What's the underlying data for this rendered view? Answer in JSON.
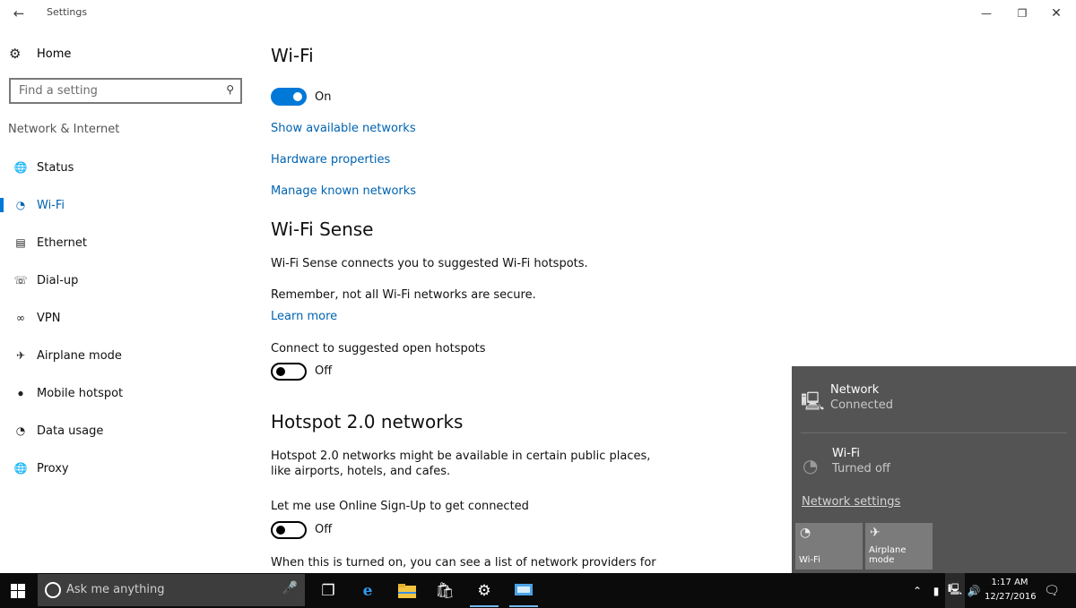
{
  "window": {
    "title": "Settings"
  },
  "sidebar": {
    "home_label": "Home",
    "search_placeholder": "Find a setting",
    "section_label": "Network & Internet",
    "items": [
      {
        "label": "Status",
        "icon": "globe-icon"
      },
      {
        "label": "Wi-Fi",
        "icon": "wifi-icon",
        "active": true
      },
      {
        "label": "Ethernet",
        "icon": "ethernet-icon"
      },
      {
        "label": "Dial-up",
        "icon": "dialup-icon"
      },
      {
        "label": "VPN",
        "icon": "vpn-icon"
      },
      {
        "label": "Airplane mode",
        "icon": "airplane-icon"
      },
      {
        "label": "Mobile hotspot",
        "icon": "hotspot-icon"
      },
      {
        "label": "Data usage",
        "icon": "data-usage-icon"
      },
      {
        "label": "Proxy",
        "icon": "proxy-globe-icon"
      }
    ]
  },
  "main": {
    "wifi_heading": "Wi-Fi",
    "wifi_toggle": {
      "state": "On",
      "on": true
    },
    "links": [
      "Show available networks",
      "Hardware properties",
      "Manage known networks"
    ],
    "sense_heading": "Wi-Fi Sense",
    "sense_text": "Wi-Fi Sense connects you to suggested Wi-Fi hotspots.",
    "sense_warning": "Remember, not all Wi-Fi networks are secure.",
    "learn_more": "Learn more",
    "hotspots_label": "Connect to suggested open hotspots",
    "hotspots_toggle": {
      "state": "Off",
      "on": false
    },
    "hotspot20_heading": "Hotspot 2.0 networks",
    "hotspot20_text_1": "Hotspot 2.0 networks might be available in certain public places,",
    "hotspot20_text_2": "like airports, hotels, and cafes.",
    "signup_label": "Let me use Online Sign-Up to get connected",
    "signup_toggle": {
      "state": "Off",
      "on": false
    },
    "providers_text": "When this is turned on, you can see a list of network providers for"
  },
  "flyout": {
    "network": {
      "name": "Network",
      "status": "Connected"
    },
    "wifi": {
      "name": "Wi-Fi",
      "status": "Turned off"
    },
    "settings_link": "Network settings",
    "tiles": [
      "Wi-Fi",
      "Airplane mode"
    ]
  },
  "taskbar": {
    "search_placeholder": "Ask me anything",
    "time": "1:17 AM",
    "date": "12/27/2016"
  },
  "colors": {
    "accent": "#0078d7",
    "link": "#0063b1",
    "flyout_bg": "#545454",
    "taskbar_bg": "#0b0b0b"
  }
}
